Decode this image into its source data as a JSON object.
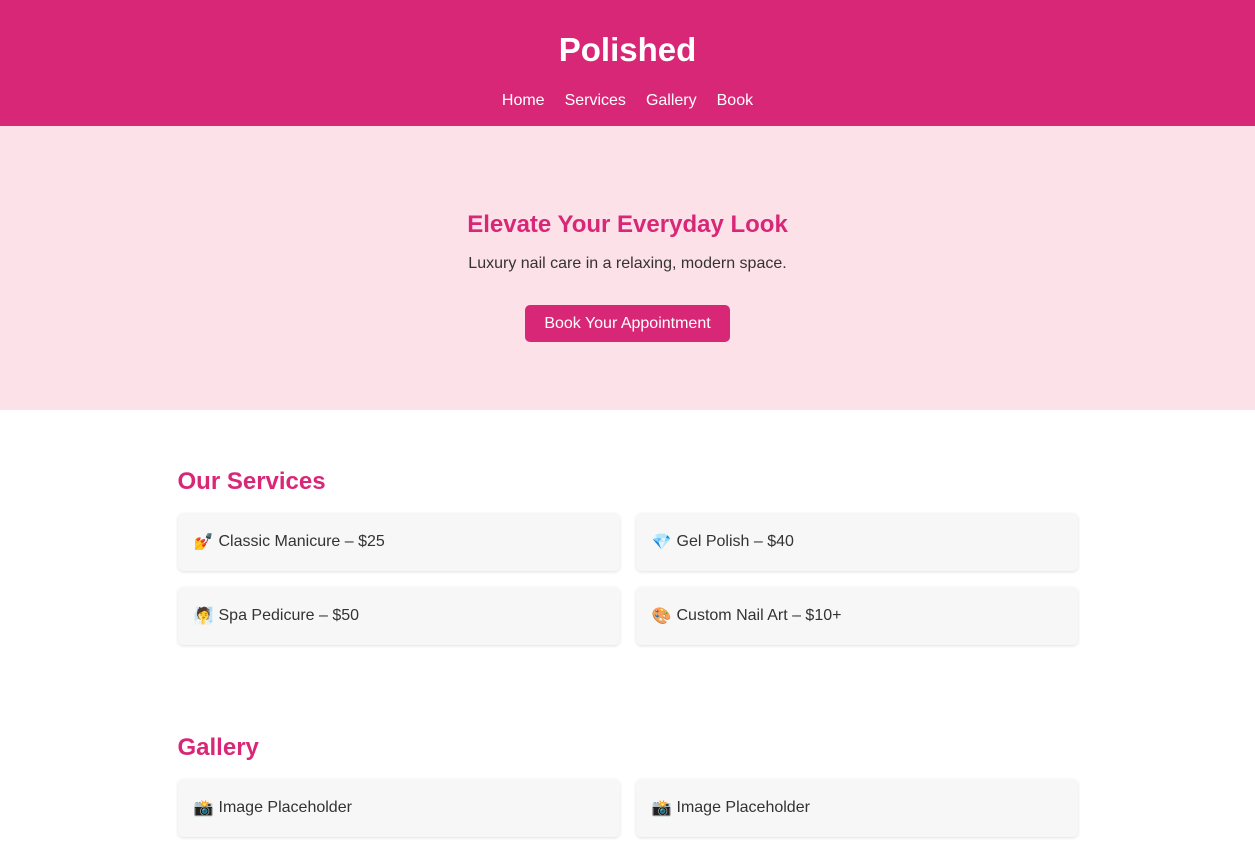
{
  "header": {
    "logo": "Polished",
    "nav": [
      "Home",
      "Services",
      "Gallery",
      "Book"
    ]
  },
  "hero": {
    "title": "Elevate Your Everyday Look",
    "subtitle": "Luxury nail care in a relaxing, modern space.",
    "cta": "Book Your Appointment"
  },
  "services": {
    "title": "Our Services",
    "items": [
      {
        "icon": "💅",
        "icon_name": "nail-polish-icon",
        "label": "Classic Manicure – $25"
      },
      {
        "icon": "💎",
        "icon_name": "gem-icon",
        "label": "Gel Polish – $40"
      },
      {
        "icon": "🧖",
        "icon_name": "spa-person-icon",
        "label": "Spa Pedicure – $50"
      },
      {
        "icon": "🎨",
        "icon_name": "palette-icon",
        "label": "Custom Nail Art – $10+"
      }
    ]
  },
  "gallery": {
    "title": "Gallery",
    "items": [
      {
        "icon": "📸",
        "icon_name": "camera-flash-icon",
        "label": "Image Placeholder"
      },
      {
        "icon": "📸",
        "icon_name": "camera-flash-icon",
        "label": "Image Placeholder"
      }
    ]
  },
  "colors": {
    "brand": "#d92777",
    "hero_background": "#fde1e8",
    "card_background": "#f7f7f7",
    "text": "#333333"
  }
}
